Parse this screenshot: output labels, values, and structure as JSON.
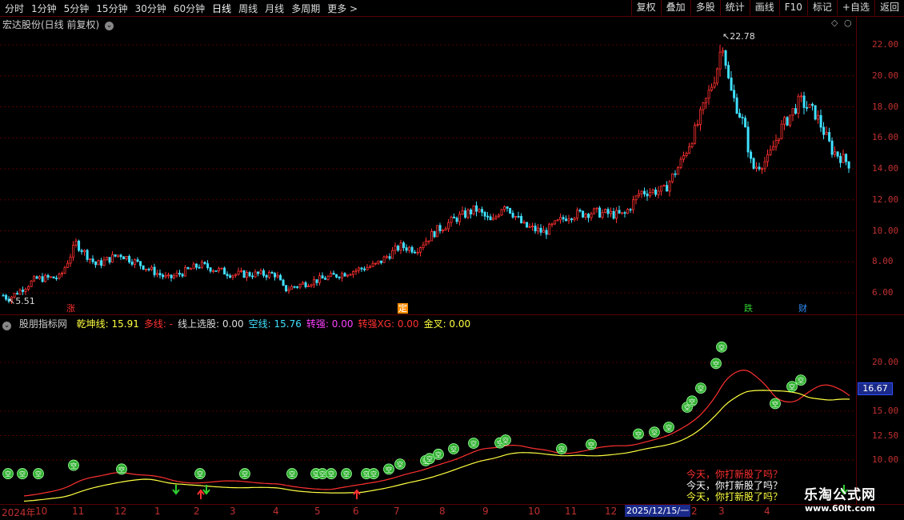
{
  "toolbar": {
    "periods": [
      "分时",
      "1分钟",
      "5分钟",
      "15分钟",
      "30分钟",
      "60分钟",
      "日线",
      "周线",
      "月线",
      "多周期",
      "更多 >"
    ],
    "active_period": "日线",
    "right_buttons": [
      "复权",
      "叠加",
      "多股",
      "统计",
      "画线",
      "F10",
      "标记",
      "+自选",
      "返回"
    ]
  },
  "price_panel": {
    "title": "宏达股份(日线 前复权)",
    "high_label": "22.78",
    "low_label": "5.51",
    "y_ticks": [
      "22.00",
      "20.00",
      "18.00",
      "16.00",
      "14.00",
      "12.00",
      "10.00",
      "8.00",
      "6.00"
    ],
    "events": [
      {
        "label": "涨",
        "color": "#ff3030"
      },
      {
        "label": "定",
        "color": "#ff8c00"
      },
      {
        "label": "跌",
        "color": "#30d030"
      },
      {
        "label": "财",
        "color": "#3090ff"
      }
    ]
  },
  "indicator_panel": {
    "name": "股朋指标网",
    "fields": [
      {
        "label": "乾坤线:",
        "value": "15.91",
        "color": "#ffff40"
      },
      {
        "label": "多线:",
        "value": "-",
        "color": "#ff3030"
      },
      {
        "label": "线上选股:",
        "value": "0.00",
        "color": "#dddddd"
      },
      {
        "label": "空线:",
        "value": "15.76",
        "color": "#40e0ff"
      },
      {
        "label": "转强:",
        "value": "0.00",
        "color": "#ff40ff"
      },
      {
        "label": "转强XG:",
        "value": "0.00",
        "color": "#ff3030"
      },
      {
        "label": "金叉:",
        "value": "0.00",
        "color": "#ffff40"
      }
    ],
    "y_ticks": [
      "20.00",
      "15.00",
      "12.50",
      "10.00"
    ],
    "current_value": "16.67",
    "marker_glyph": "空",
    "notes": [
      {
        "text": "今天，你打新股了吗？",
        "color": "#ff3030"
      },
      {
        "text": "今天，你打新股了吗？",
        "color": "#ffffff"
      },
      {
        "text": "今天，你打新股了吗？",
        "color": "#ffff40"
      }
    ]
  },
  "date_axis": {
    "labels": [
      "2024年",
      "10",
      "11",
      "12",
      "1",
      "2",
      "3",
      "4",
      "5",
      "6",
      "7",
      "8",
      "9",
      "10",
      "11",
      "12",
      "2025/12/15/一",
      "2",
      "3",
      "4"
    ],
    "highlighted": "2025/12/15/一"
  },
  "watermark": {
    "name": "乐淘公式网",
    "url": "www.60lt.com"
  },
  "colors": {
    "up": "#ff3030",
    "down": "#40e0ff",
    "grid": "#5a0000",
    "axis_text": "#c03030"
  }
}
